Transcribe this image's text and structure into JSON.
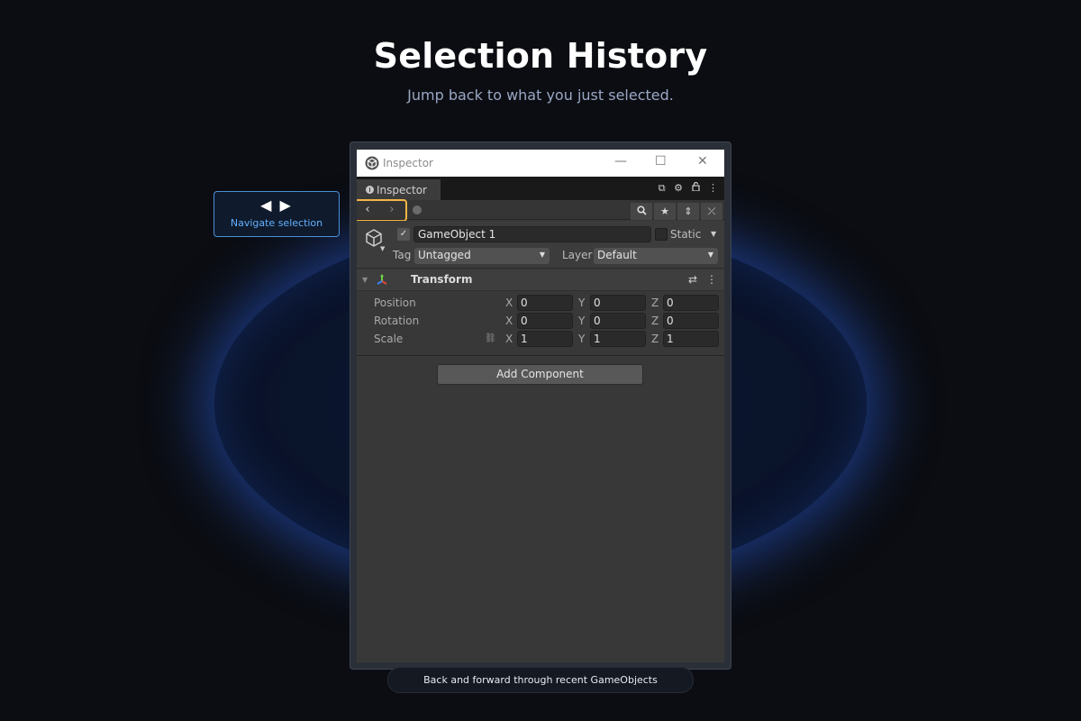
{
  "hero": {
    "title": "Selection History",
    "subtitle": "Jump back to what you just selected."
  },
  "callout": {
    "arrows": "◀ ▶",
    "label": "Navigate selection",
    "accent": "#4a8fd6"
  },
  "window": {
    "title": "Inspector",
    "minimize": "—",
    "maximize": "☐",
    "close": "✕"
  },
  "tab": {
    "label": "Inspector",
    "icon": "info-icon",
    "right_icons": [
      "open-window-icon",
      "gear-icon",
      "lock-icon",
      "more-icon"
    ]
  },
  "navigation": {
    "back_glyph": "‹",
    "forward_glyph": "›",
    "highlight_color": "#f5b544",
    "tool_icons": [
      "search-icon",
      "star-icon",
      "expand-icon",
      "collapse-icon"
    ]
  },
  "gameobject": {
    "active": true,
    "name": "GameObject 1",
    "static_label": "Static",
    "tag_label": "Tag",
    "tag_value": "Untagged",
    "layer_label": "Layer",
    "layer_value": "Default"
  },
  "transform": {
    "title": "Transform",
    "rows": [
      {
        "label": "Position",
        "x": "0",
        "y": "0",
        "z": "0"
      },
      {
        "label": "Rotation",
        "x": "0",
        "y": "0",
        "z": "0"
      },
      {
        "label": "Scale",
        "x": "1",
        "y": "1",
        "z": "1"
      }
    ],
    "axes": [
      "X",
      "Y",
      "Z"
    ]
  },
  "add_component": "Add Component",
  "caption": "Back and forward through recent GameObjects"
}
